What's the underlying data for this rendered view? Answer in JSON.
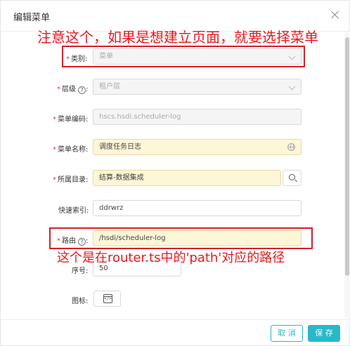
{
  "dialog": {
    "title": "编辑菜单",
    "close_label": "×"
  },
  "annotations": {
    "top": "注意这个，如果是想建立页面，就要选择菜单",
    "bottom": "这个是在router.ts中的'path'对应的路径",
    "color": "#e8191d"
  },
  "form": {
    "category": {
      "required_mark": "*",
      "label": "类别:",
      "value": "菜单"
    },
    "level": {
      "required_mark": "*",
      "label": "层级",
      "help": "?",
      "value": "租户层"
    },
    "menu_code": {
      "required_mark": "*",
      "label": "菜单编码:",
      "value": "hscs.hsdi.scheduler-log"
    },
    "menu_name": {
      "required_mark": "*",
      "label": "菜单名称:",
      "value": "调度任务日志",
      "icon": "globe-icon"
    },
    "parent_dir": {
      "required_mark": "*",
      "label": "所属目录:",
      "value": "结算-数据集成",
      "icon": "search-icon"
    },
    "quick_index": {
      "label": "快速索引:",
      "value": "ddrwrz"
    },
    "route": {
      "required_mark": "*",
      "label": "路由",
      "help": "?",
      "value": "/hsdi/scheduler-log"
    },
    "sort_order": {
      "label": "序号:",
      "value": "50"
    },
    "icon_field": {
      "label": "图标:",
      "icon": "code-icon",
      "icon_glyph": "</>"
    }
  },
  "footer": {
    "cancel_label": "取 消",
    "save_label": "保 存",
    "accent_color": "#29b8c9"
  }
}
